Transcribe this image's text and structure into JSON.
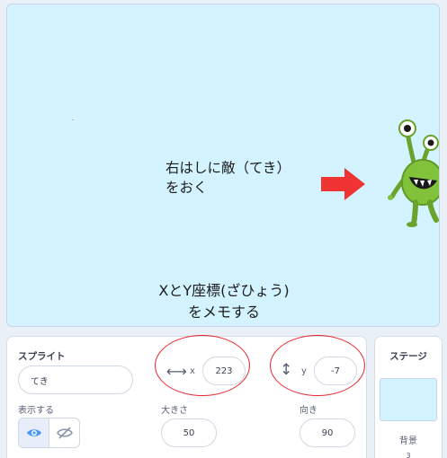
{
  "stage": {
    "note_enemy": "右はしに敵（てき）\nをおく",
    "note_memo": "XとY座標(ざひょう)\nをメモする",
    "arrow_color": "#f03434",
    "alien_color": "#82c23a"
  },
  "sprite_panel": {
    "title": "スプライト",
    "name_value": "てき",
    "x_label": "x",
    "x_value": "223",
    "y_label": "y",
    "y_value": "-7",
    "show_label": "表示する",
    "size_label": "大きさ",
    "size_value": "50",
    "direction_label": "向き",
    "direction_value": "90",
    "x_icon": "horizontal-arrows-icon",
    "y_icon": "vertical-arrows-icon"
  },
  "stage_panel": {
    "title": "ステージ",
    "backdrops_label": "背景",
    "backdrops_count": "3"
  },
  "annotation_color": "#e8252e"
}
